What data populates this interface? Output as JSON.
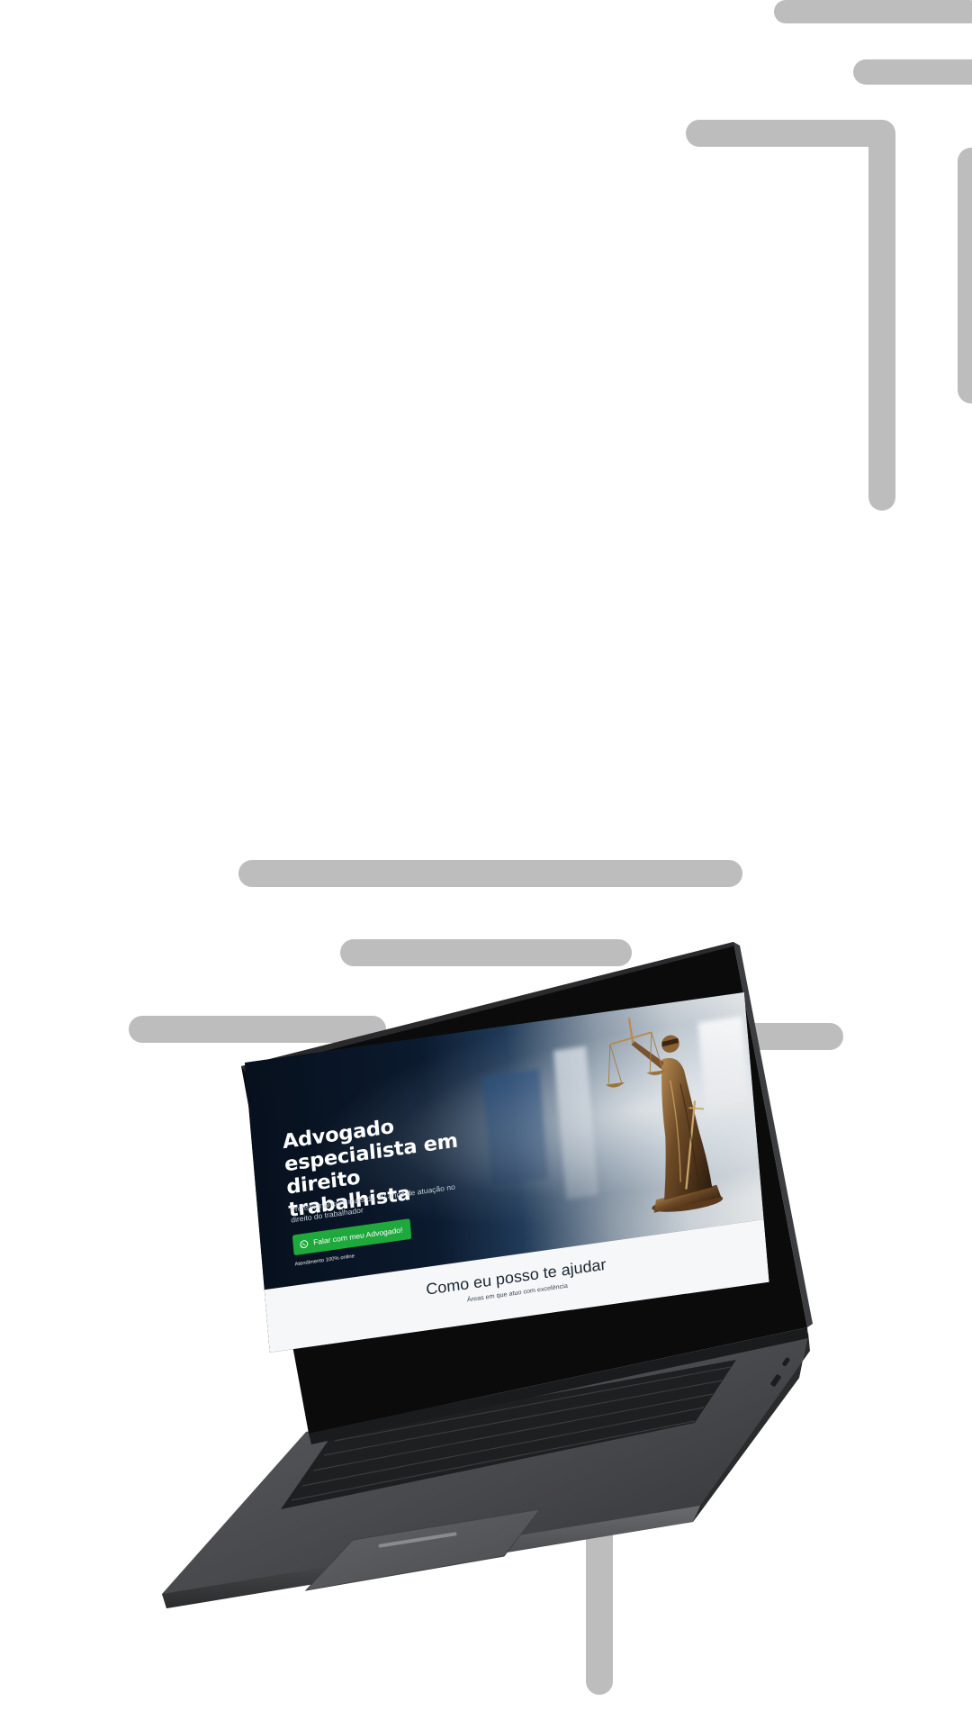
{
  "hero": {
    "title": "Advogado especialista em direito trabalhista",
    "subtitle": "Profissional com mais de 30 anos de atuação no direito do trabalhador",
    "cta_label": "Falar com meu Advogado!",
    "cta_note": "Atendimento 100% online"
  },
  "section": {
    "title": "Como eu posso te ajudar",
    "subtitle": "Áreas em que atuo com excelência"
  },
  "icons": {
    "cta_icon": "whatsapp-icon",
    "statue": "lady-justice-statue"
  },
  "colors": {
    "background": "#ffffff",
    "decor_bars": "#bdbdbd",
    "cta": "#1fa83c",
    "hero_dark": "#0b1a2e",
    "laptop_body": "#4a4a4c"
  }
}
